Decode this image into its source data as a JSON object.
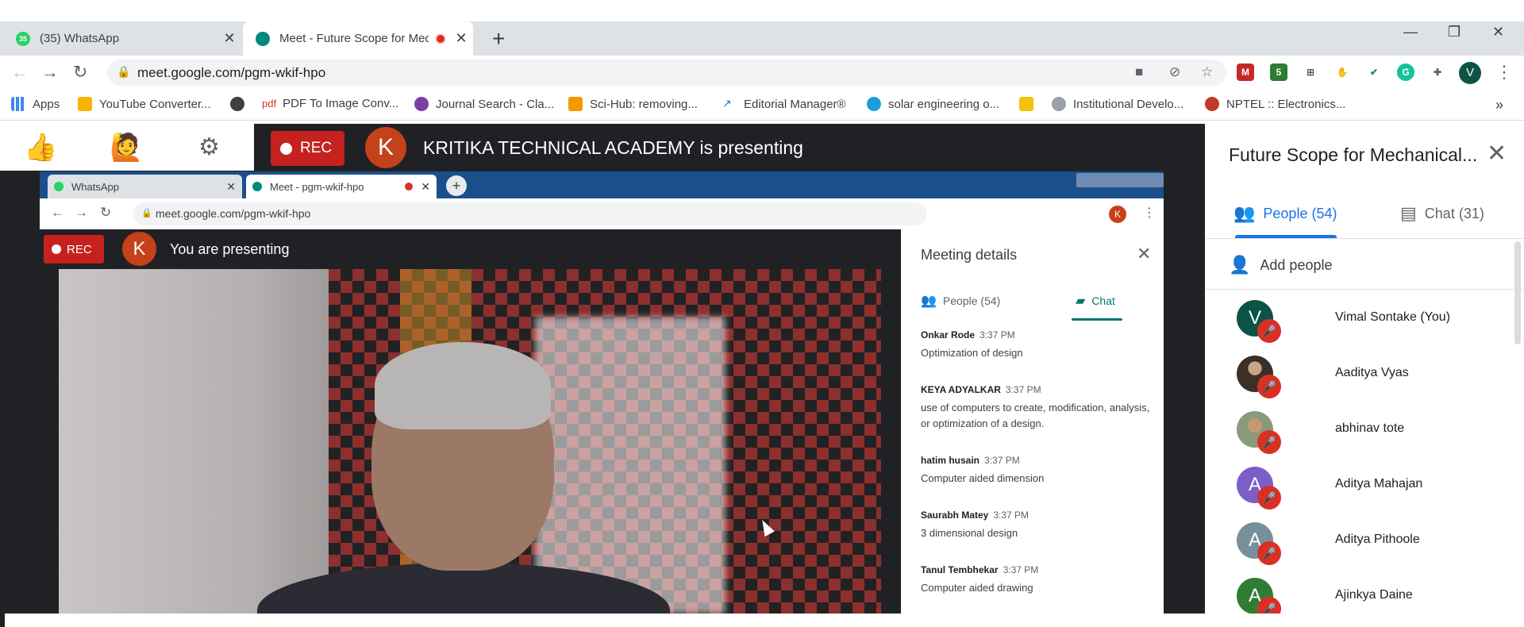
{
  "browser": {
    "tabs": [
      {
        "title": "(35) WhatsApp",
        "badge": "35"
      },
      {
        "title": "Meet - Future Scope for Mec"
      }
    ],
    "url": "meet.google.com/pgm-wkif-hpo",
    "extension_badge": "5",
    "profile_initial": "V"
  },
  "bookmarks": [
    {
      "label": "Apps",
      "color": "#4285f4"
    },
    {
      "label": "YouTube Converter...",
      "color": "#f4b400"
    },
    {
      "label": "",
      "color": "#3c4043"
    },
    {
      "label": "PDF To Image Conv...",
      "color": "#d93025",
      "prefix": "pdf"
    },
    {
      "label": "Journal Search - Cla...",
      "color": "#7b3fa0"
    },
    {
      "label": "Sci-Hub: removing...",
      "color": "#f29900"
    },
    {
      "label": "Editorial Manager®",
      "color": "#1a73e8"
    },
    {
      "label": "solar engineering o...",
      "color": "#1a9fd8"
    },
    {
      "label": "",
      "color": "#f4c20d"
    },
    {
      "label": "Institutional Develo...",
      "color": "#9aa0a6"
    },
    {
      "label": "NPTEL :: Electronics...",
      "color": "#c0392b"
    }
  ],
  "meet": {
    "rec_label": "REC",
    "presenter_initial": "K",
    "presenting_text": "KRITIKA TECHNICAL ACADEMY is presenting"
  },
  "shared_screen": {
    "tabs": [
      "WhatsApp",
      "Meet - pgm-wkif-hpo"
    ],
    "url": "meet.google.com/pgm-wkif-hpo",
    "rec_label": "REC",
    "presenter_initial": "K",
    "presenting_text": "You are presenting",
    "panel_title": "Meeting details",
    "people_tab": "People (54)",
    "chat_tab": "Chat",
    "messages": [
      {
        "name": "Onkar Rode",
        "time": "3:37 PM",
        "text": "Optimization of design"
      },
      {
        "name": "KEYA ADYALKAR",
        "time": "3:37 PM",
        "text": " use of computers to create, modification, analysis, or optimization of a design."
      },
      {
        "name": "hatim husain",
        "time": "3:37 PM",
        "text": "Computer aided dimension"
      },
      {
        "name": "Saurabh Matey",
        "time": "3:37 PM",
        "text": "3 dimensional design"
      },
      {
        "name": "Tanul Tembhekar",
        "time": "3:37 PM",
        "text": "Computer aided drawing"
      }
    ]
  },
  "side_panel": {
    "title": "Future Scope for Mechanical...",
    "people_tab": "People (54)",
    "chat_tab": "Chat (31)",
    "add_people": "Add people",
    "participants": [
      {
        "name": "Vimal Sontake (You)",
        "initial": "V",
        "color": "#0b5345"
      },
      {
        "name": "Aaditya Vyas",
        "initial": "",
        "color": "#5a4a3f"
      },
      {
        "name": "abhinav tote",
        "initial": "",
        "color": "#7a8a6a"
      },
      {
        "name": "Aditya Mahajan",
        "initial": "A",
        "color": "#7b5fc7"
      },
      {
        "name": "Aditya Pithoole",
        "initial": "A",
        "color": "#78909c"
      },
      {
        "name": "Ajinkya Daine",
        "initial": "A",
        "color": "#2e7d32"
      }
    ]
  }
}
